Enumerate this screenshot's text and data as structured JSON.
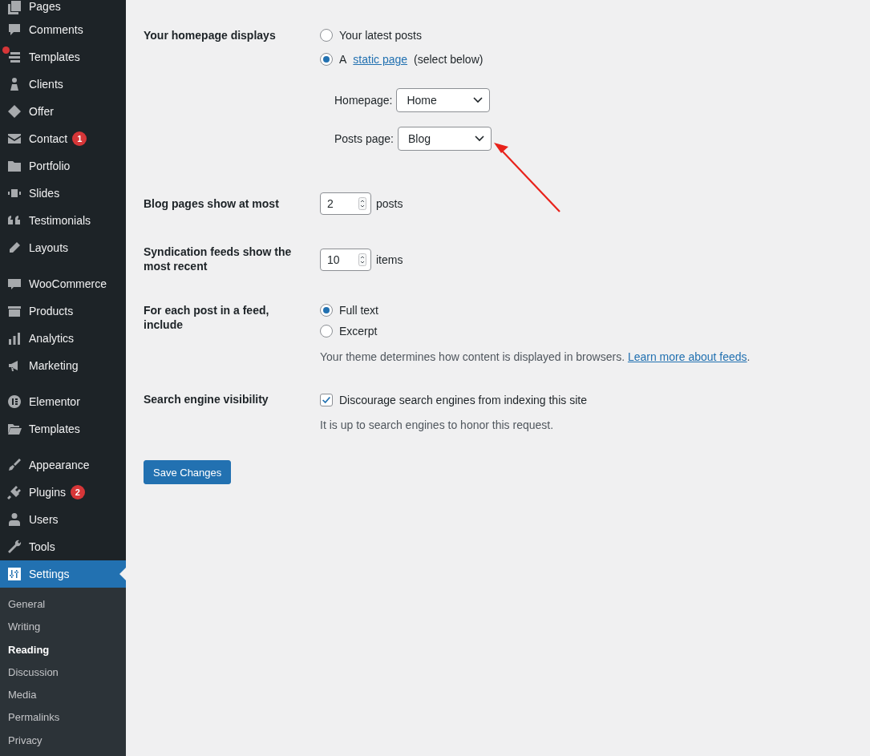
{
  "sidebar": {
    "groups": [
      {
        "items": [
          {
            "label": "Pages",
            "notification": false,
            "selected": false
          },
          {
            "label": "Comments",
            "notification": false,
            "selected": false
          },
          {
            "label": "Templates",
            "notification": true,
            "selected": false
          },
          {
            "label": "Clients",
            "notification": false,
            "selected": false
          },
          {
            "label": "Offer",
            "notification": false,
            "selected": false
          },
          {
            "label": "Contact",
            "badge": "1",
            "notification": false,
            "selected": false
          },
          {
            "label": "Portfolio",
            "notification": false,
            "selected": false
          },
          {
            "label": "Slides",
            "notification": false,
            "selected": false
          },
          {
            "label": "Testimonials",
            "notification": false,
            "selected": false
          },
          {
            "label": "Layouts",
            "notification": false,
            "selected": false
          }
        ]
      },
      {
        "items": [
          {
            "label": "WooCommerce",
            "notification": false,
            "selected": false
          },
          {
            "label": "Products",
            "notification": false,
            "selected": false
          },
          {
            "label": "Analytics",
            "notification": false,
            "selected": false
          },
          {
            "label": "Marketing",
            "notification": false,
            "selected": false
          }
        ]
      },
      {
        "items": [
          {
            "label": "Elementor",
            "notification": false,
            "selected": false
          },
          {
            "label": "Templates",
            "notification": false,
            "selected": false
          }
        ]
      },
      {
        "items": [
          {
            "label": "Appearance",
            "notification": false,
            "selected": false
          },
          {
            "label": "Plugins",
            "badge": "2",
            "notification": false,
            "selected": false
          },
          {
            "label": "Users",
            "notification": false,
            "selected": false
          },
          {
            "label": "Tools",
            "notification": false,
            "selected": false
          },
          {
            "label": "Settings",
            "notification": false,
            "selected": true
          }
        ]
      }
    ],
    "submenu": [
      {
        "label": "General",
        "selected": false
      },
      {
        "label": "Writing",
        "selected": false
      },
      {
        "label": "Reading",
        "selected": true
      },
      {
        "label": "Discussion",
        "selected": false
      },
      {
        "label": "Media",
        "selected": false
      },
      {
        "label": "Permalinks",
        "selected": false
      },
      {
        "label": "Privacy",
        "selected": false
      }
    ]
  },
  "form": {
    "homepage_displays": {
      "label": "Your homepage displays",
      "options": [
        {
          "prefix": "Your latest posts",
          "selected": false
        },
        {
          "prefix": "A",
          "link": "static page",
          "suffix": "(select below)",
          "selected": true
        }
      ],
      "selects": [
        {
          "label": "Homepage:",
          "value": "Home"
        },
        {
          "label": "Posts page:",
          "value": "Blog"
        }
      ]
    },
    "blog_pages": {
      "label": "Blog pages show at most",
      "value": "2",
      "unit": "posts"
    },
    "syndication": {
      "label": "Syndication feeds show the most recent",
      "value": "10",
      "unit": "items"
    },
    "feed_content": {
      "label": "For each post in a feed, include",
      "options": [
        {
          "label": "Full text",
          "selected": true
        },
        {
          "label": "Excerpt",
          "selected": false
        }
      ],
      "description": "Your theme determines how content is displayed in browsers.",
      "link": "Learn more about feeds",
      "suffix": "."
    },
    "search_visibility": {
      "label": "Search engine visibility",
      "checkbox": {
        "label": "Discourage search engines from indexing this site",
        "checked": true
      },
      "note": "It is up to search engines to honor this request."
    },
    "save_button": "Save Changes"
  }
}
